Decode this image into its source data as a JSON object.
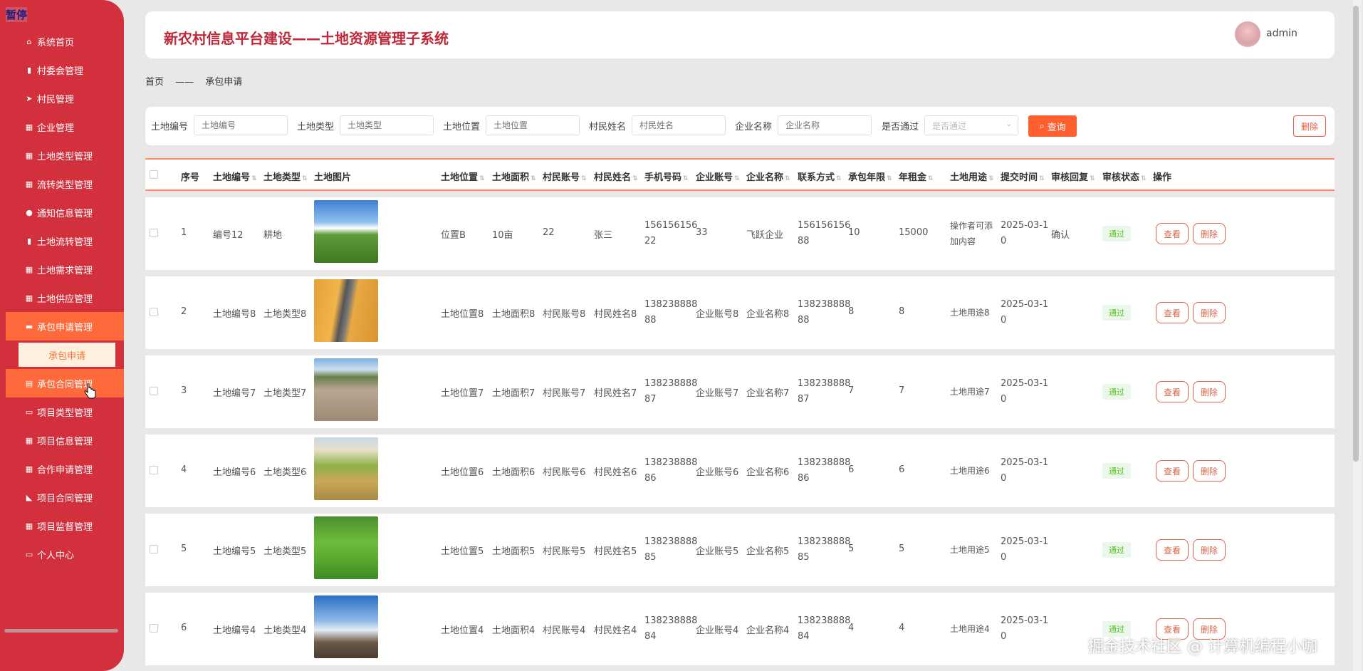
{
  "pause_tag": "暂停",
  "sidebar": {
    "items": [
      {
        "label": "系统首页",
        "icon": "home-icon"
      },
      {
        "label": "村委会管理",
        "icon": "clipboard-icon"
      },
      {
        "label": "村民管理",
        "icon": "send-icon"
      },
      {
        "label": "企业管理",
        "icon": "grid-icon"
      },
      {
        "label": "土地类型管理",
        "icon": "grid-icon"
      },
      {
        "label": "流转类型管理",
        "icon": "grid-icon"
      },
      {
        "label": "通知信息管理",
        "icon": "user-icon"
      },
      {
        "label": "土地流转管理",
        "icon": "clipboard-icon"
      },
      {
        "label": "土地需求管理",
        "icon": "grid-icon"
      },
      {
        "label": "土地供应管理",
        "icon": "grid-icon"
      },
      {
        "label": "承包申请管理",
        "icon": "ticket-icon"
      },
      {
        "label": "承包合同管理",
        "icon": "printer-icon"
      },
      {
        "label": "项目类型管理",
        "icon": "chat-icon"
      },
      {
        "label": "项目信息管理",
        "icon": "grid-icon"
      },
      {
        "label": "合作申请管理",
        "icon": "grid-icon"
      },
      {
        "label": "项目合同管理",
        "icon": "like-icon"
      },
      {
        "label": "项目监督管理",
        "icon": "grid-icon"
      },
      {
        "label": "个人中心",
        "icon": "card-icon"
      }
    ],
    "submenu": "承包申请"
  },
  "header": {
    "title": "新农村信息平台建设——土地资源管理子系统",
    "user": "admin"
  },
  "breadcrumb": {
    "home": "首页",
    "sep": "——",
    "current": "承包申请"
  },
  "search": {
    "fields": [
      {
        "label": "土地编号",
        "placeholder": "土地编号"
      },
      {
        "label": "土地类型",
        "placeholder": "土地类型"
      },
      {
        "label": "土地位置",
        "placeholder": "土地位置"
      },
      {
        "label": "村民姓名",
        "placeholder": "村民姓名"
      },
      {
        "label": "企业名称",
        "placeholder": "企业名称"
      }
    ],
    "select_label": "是否通过",
    "select_placeholder": "是否通过",
    "query_button": "查询",
    "delete_button": "删除"
  },
  "table": {
    "columns": [
      "序号",
      "土地编号",
      "土地类型",
      "土地图片",
      "土地位置",
      "土地面积",
      "村民账号",
      "村民姓名",
      "手机号码",
      "企业账号",
      "企业名称",
      "联系方式",
      "承包年限",
      "年租金",
      "土地用途",
      "提交时间",
      "审核回复",
      "审核状态",
      "操作"
    ],
    "rows": [
      {
        "no": "1",
        "land_no": "编号12",
        "land_type": "耕地",
        "location": "位置B",
        "area": "10亩",
        "villager_acct": "22",
        "villager_name": "张三",
        "phone_a": "156156156",
        "phone_b": "22",
        "ent_acct": "33",
        "ent_name": "飞跃企业",
        "contact_a": "156156156",
        "contact_b": "88",
        "years": "10",
        "rent": "15000",
        "usage_a": "操作者可添",
        "usage_b": "加内容",
        "time_a": "2025-03-1",
        "time_b": "0",
        "reply": "确认",
        "status": "通过"
      },
      {
        "no": "2",
        "land_no": "土地编号8",
        "land_type": "土地类型8",
        "location": "土地位置8",
        "area": "土地面积8",
        "villager_acct": "村民账号8",
        "villager_name": "村民姓名8",
        "phone_a": "138238888",
        "phone_b": "88",
        "ent_acct": "企业账号8",
        "ent_name": "企业名称8",
        "contact_a": "138238888",
        "contact_b": "88",
        "years": "8",
        "rent": "8",
        "usage_a": "土地用途8",
        "usage_b": "",
        "time_a": "2025-03-1",
        "time_b": "0",
        "reply": "",
        "status": "通过"
      },
      {
        "no": "3",
        "land_no": "土地编号7",
        "land_type": "土地类型7",
        "location": "土地位置7",
        "area": "土地面积7",
        "villager_acct": "村民账号7",
        "villager_name": "村民姓名7",
        "phone_a": "138238888",
        "phone_b": "87",
        "ent_acct": "企业账号7",
        "ent_name": "企业名称7",
        "contact_a": "138238888",
        "contact_b": "87",
        "years": "7",
        "rent": "7",
        "usage_a": "土地用途7",
        "usage_b": "",
        "time_a": "2025-03-1",
        "time_b": "0",
        "reply": "",
        "status": "通过"
      },
      {
        "no": "4",
        "land_no": "土地编号6",
        "land_type": "土地类型6",
        "location": "土地位置6",
        "area": "土地面积6",
        "villager_acct": "村民账号6",
        "villager_name": "村民姓名6",
        "phone_a": "138238888",
        "phone_b": "86",
        "ent_acct": "企业账号6",
        "ent_name": "企业名称6",
        "contact_a": "138238888",
        "contact_b": "86",
        "years": "6",
        "rent": "6",
        "usage_a": "土地用途6",
        "usage_b": "",
        "time_a": "2025-03-1",
        "time_b": "0",
        "reply": "",
        "status": "通过"
      },
      {
        "no": "5",
        "land_no": "土地编号5",
        "land_type": "土地类型5",
        "location": "土地位置5",
        "area": "土地面积5",
        "villager_acct": "村民账号5",
        "villager_name": "村民姓名5",
        "phone_a": "138238888",
        "phone_b": "85",
        "ent_acct": "企业账号5",
        "ent_name": "企业名称5",
        "contact_a": "138238888",
        "contact_b": "85",
        "years": "5",
        "rent": "5",
        "usage_a": "土地用途5",
        "usage_b": "",
        "time_a": "2025-03-1",
        "time_b": "0",
        "reply": "",
        "status": "通过"
      },
      {
        "no": "6",
        "land_no": "土地编号4",
        "land_type": "土地类型4",
        "location": "土地位置4",
        "area": "土地面积4",
        "villager_acct": "村民账号4",
        "villager_name": "村民姓名4",
        "phone_a": "138238888",
        "phone_b": "84",
        "ent_acct": "企业账号4",
        "ent_name": "企业名称4",
        "contact_a": "138238888",
        "contact_b": "84",
        "years": "4",
        "rent": "4",
        "usage_a": "土地用途4",
        "usage_b": "",
        "time_a": "2025-03-1",
        "time_b": "0",
        "reply": "",
        "status": "通过"
      }
    ],
    "view_button": "查看",
    "delete_button": "删除"
  },
  "watermark": "掘金技术社区 @ 计算机编程小咖",
  "colors": {
    "sidebar": "#d3303e",
    "accent": "#ff5e2e",
    "title": "#c0283a",
    "pass": "#52c41a"
  }
}
